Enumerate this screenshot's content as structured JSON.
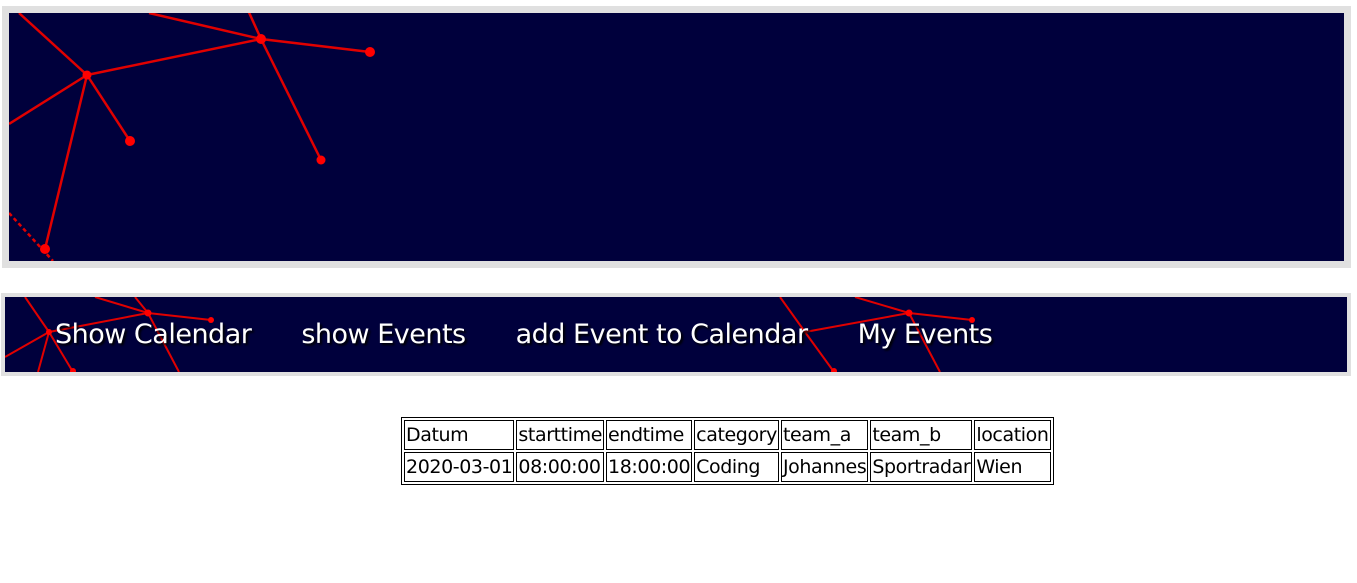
{
  "banner": {
    "background_color": "#00003c",
    "art_color": "#e00000",
    "art_description_icon": "network-graph-decoration"
  },
  "nav": {
    "items": [
      {
        "label": "Show Calendar"
      },
      {
        "label": "show Events"
      },
      {
        "label": "add Event to Calendar"
      },
      {
        "label": "My Events"
      }
    ]
  },
  "table": {
    "headers": [
      "Datum",
      "starttime",
      "endtime",
      "category",
      "team_a",
      "team_b",
      "location"
    ],
    "rows": [
      [
        "2020-03-01",
        "08:00:00",
        "18:00:00",
        "Coding",
        "Johannes",
        "Sportradar",
        "Wien"
      ]
    ]
  }
}
